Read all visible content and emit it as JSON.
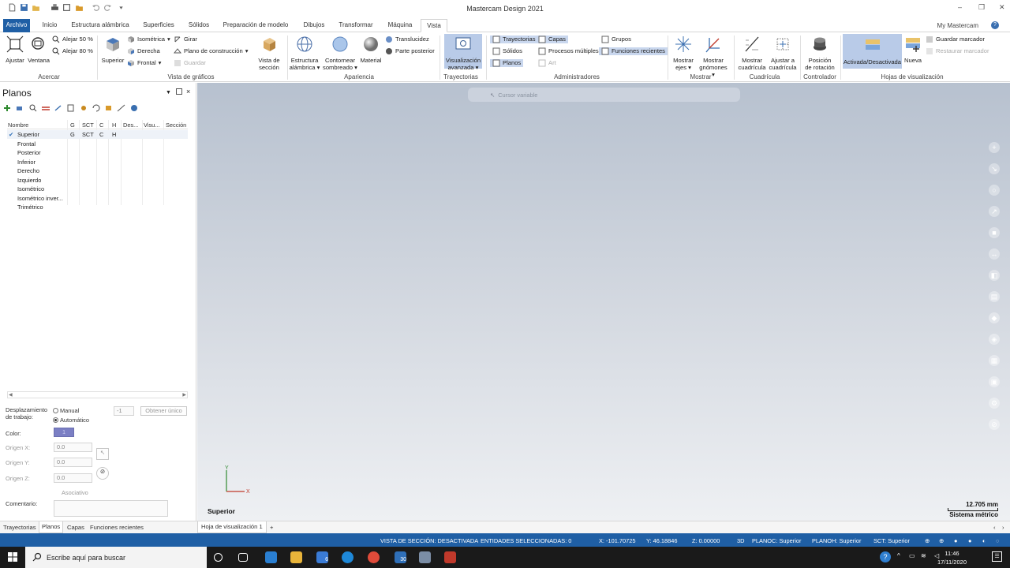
{
  "window": {
    "title": "Mastercam Design 2021",
    "my_mastercam": "My Mastercam"
  },
  "tabs": [
    "Archivo",
    "Inicio",
    "Estructura alámbrica",
    "Superficies",
    "Sólidos",
    "Preparación de modelo",
    "Dibujos",
    "Transformar",
    "Máquina",
    "Vista"
  ],
  "ribbon": {
    "ajustar": "Ajustar",
    "ventana": "Ventana",
    "alejar50": "Alejar 50 %",
    "alejar80": "Alejar 80 %",
    "acercar": "Acercar",
    "superior": "Superior",
    "isometrica": "Isométrica",
    "derecha": "Derecha",
    "frontal": "Frontal",
    "girar": "Girar",
    "plano_construccion": "Plano de construcción",
    "guardar": "Guardar",
    "vista_seccion_1": "Vista de",
    "vista_seccion_2": "sección",
    "vista_graficos": "Vista de gráficos",
    "estructura_1": "Estructura",
    "estructura_2": "alámbrica",
    "contornear_1": "Contornear",
    "contornear_2": "sombreado",
    "material": "Material",
    "translucidez": "Translucidez",
    "parte_posterior": "Parte posterior",
    "apariencia": "Apariencia",
    "visualizacion_1": "Visualización",
    "visualizacion_2": "avanzada",
    "trayectorias_grp": "Trayectorias",
    "m_trayectorias": "Trayectorias",
    "m_capas": "Capas",
    "m_solidos": "Sólidos",
    "m_procesos": "Procesos múltiples",
    "m_planos": "Planos",
    "m_art": "Art",
    "m_grupos": "Grupos",
    "m_funciones": "Funciones recientes",
    "administradores": "Administradores",
    "mostrar_ejes_1": "Mostrar",
    "mostrar_ejes_2": "ejes",
    "mostrar_gnomones_1": "Mostrar",
    "mostrar_gnomones_2": "gnómones",
    "mostrar": "Mostrar",
    "mostrar_cuad_1": "Mostrar",
    "mostrar_cuad_2": "cuadrícula",
    "ajustar_cuad_1": "Ajustar a",
    "ajustar_cuad_2": "cuadrícula",
    "cuadricula": "Cuadrícula",
    "posicion_1": "Posición",
    "posicion_2": "de rotación",
    "controlador": "Controlador",
    "activada": "Activada/Desactivada",
    "nueva": "Nueva",
    "guardar_marcador": "Guardar marcador",
    "restaurar_marcador": "Restaurar marcador",
    "hojas": "Hojas de visualización"
  },
  "panel": {
    "title": "Planos",
    "columns": [
      "Nombre",
      "G",
      "SCT",
      "C",
      "H",
      "Des...",
      "Visu...",
      "Sección"
    ],
    "rows": [
      {
        "name": "Superior",
        "g": "G",
        "sct": "SCT",
        "c": "C",
        "h": "H"
      },
      {
        "name": "Frontal"
      },
      {
        "name": "Posterior"
      },
      {
        "name": "Inferior"
      },
      {
        "name": "Derecho"
      },
      {
        "name": "Izquierdo"
      },
      {
        "name": "Isométrico"
      },
      {
        "name": "Isométrico inver..."
      },
      {
        "name": "Trimétrico"
      }
    ],
    "desplazamiento_1": "Desplazamiento",
    "desplazamiento_2": "de trabajo:",
    "manual": "Manual",
    "automatico": "Automático",
    "offset_value": "-1",
    "obtener": "Obtener único",
    "color": "Color:",
    "color_value": "1",
    "color_hex": "#7b7fc4",
    "origen_x": "Origen X:",
    "origen_y": "Origen Y:",
    "origen_z": "Origen Z:",
    "origen_x_value": "0.0",
    "origen_y_value": "0.0",
    "origen_z_value": "0.0",
    "asociativo": "Asociativo",
    "comentario": "Comentario:"
  },
  "bottom_tabs": [
    "Trayectorias",
    "Planos",
    "Capas",
    "Funciones recientes"
  ],
  "view_sheet_tab": "Hoja de visualización 1",
  "add_sheet": "+",
  "viewport": {
    "cursor_bar": "Cursor variable",
    "view_name": "Superior",
    "scale": "12.705 mm",
    "units": "Sistema métrico",
    "axis_x": "X",
    "axis_y": "Y"
  },
  "status": {
    "vista_seccion": "VISTA DE SECCIÓN: DESACTIVADA",
    "entidades": "ENTIDADES SELECCIONADAS: 0",
    "x": "X:   -101.70725",
    "y": "Y:   46.18846",
    "z": "Z:   0.00000",
    "mode": "3D",
    "planoc": "PLANOC: Superior",
    "planoh": "PLANOH: Superior",
    "sct": "SCT: Superior"
  },
  "taskbar": {
    "search": "Escribe aquí para buscar",
    "time": "11:46",
    "date": "17/11/2020",
    "badge_mail": "6",
    "badge_store": "30"
  },
  "colors": {
    "accent": "#1f5fa5",
    "highlight": "#c9d7ee"
  }
}
